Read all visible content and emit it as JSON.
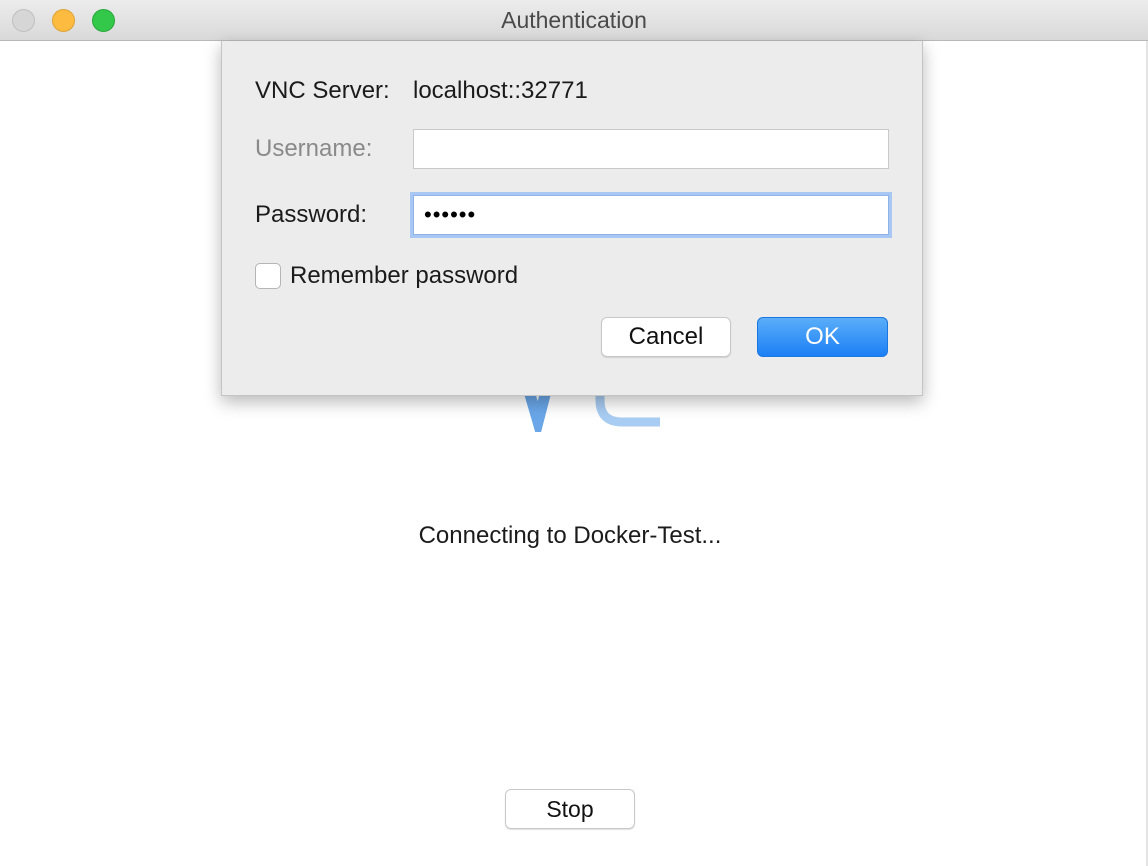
{
  "window": {
    "title": "Authentication"
  },
  "dialog": {
    "server_label": "VNC Server:",
    "server_value": "localhost::32771",
    "username_label": "Username:",
    "username_value": "",
    "password_label": "Password:",
    "password_value": "••••••",
    "remember_label": "Remember password",
    "remember_checked": false,
    "cancel_label": "Cancel",
    "ok_label": "OK"
  },
  "main": {
    "status": "Connecting to Docker-Test...",
    "stop_label": "Stop"
  },
  "colors": {
    "accent": "#1c7ff5",
    "focus_ring": "#a8c8f3",
    "logo": "#6aa6e8"
  }
}
